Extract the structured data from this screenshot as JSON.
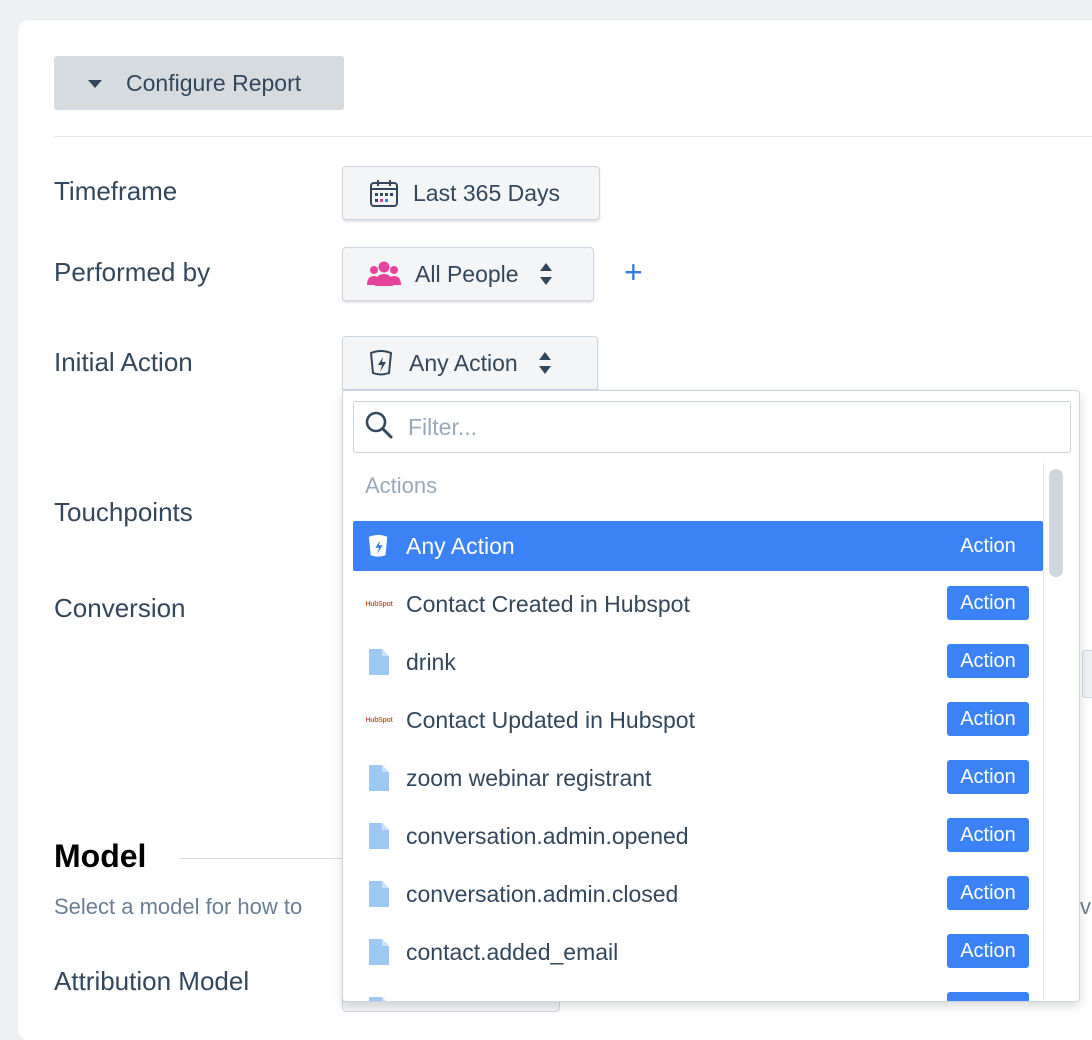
{
  "configure": {
    "label": "Configure Report"
  },
  "rows": {
    "timeframe": {
      "label": "Timeframe",
      "value": "Last 365 Days"
    },
    "performed_by": {
      "label": "Performed by",
      "value": "All People"
    },
    "initial_action": {
      "label": "Initial Action",
      "value": "Any Action"
    },
    "touchpoints": {
      "label": "Touchpoints"
    },
    "conversion": {
      "label": "Conversion"
    }
  },
  "model": {
    "heading": "Model",
    "description": "Select a model for how to",
    "description_tail": "ve",
    "attribution_label": "Attribution Model"
  },
  "dropdown": {
    "filter_placeholder": "Filter...",
    "section_header": "Actions",
    "items": [
      {
        "label": "Any Action",
        "badge": "Action",
        "icon": "any-action-icon",
        "selected": true
      },
      {
        "label": "Contact Created in Hubspot",
        "badge": "Action",
        "icon": "hubspot-logo-icon"
      },
      {
        "label": "drink",
        "badge": "Action",
        "icon": "document-icon"
      },
      {
        "label": "Contact Updated in Hubspot",
        "badge": "Action",
        "icon": "hubspot-logo-icon"
      },
      {
        "label": "zoom webinar registrant",
        "badge": "Action",
        "icon": "document-icon"
      },
      {
        "label": "conversation.admin.opened",
        "badge": "Action",
        "icon": "document-icon"
      },
      {
        "label": "conversation.admin.closed",
        "badge": "Action",
        "icon": "document-icon"
      },
      {
        "label": "contact.added_email",
        "badge": "Action",
        "icon": "document-icon"
      },
      {
        "label": "",
        "badge": "",
        "icon": "document-icon"
      }
    ],
    "hubspot_logo_text": "HubSpot"
  },
  "colors": {
    "accent": "#3b82f6",
    "plus": "#2f7de1",
    "people_icon": "#e8439b",
    "text": "#33475b"
  }
}
